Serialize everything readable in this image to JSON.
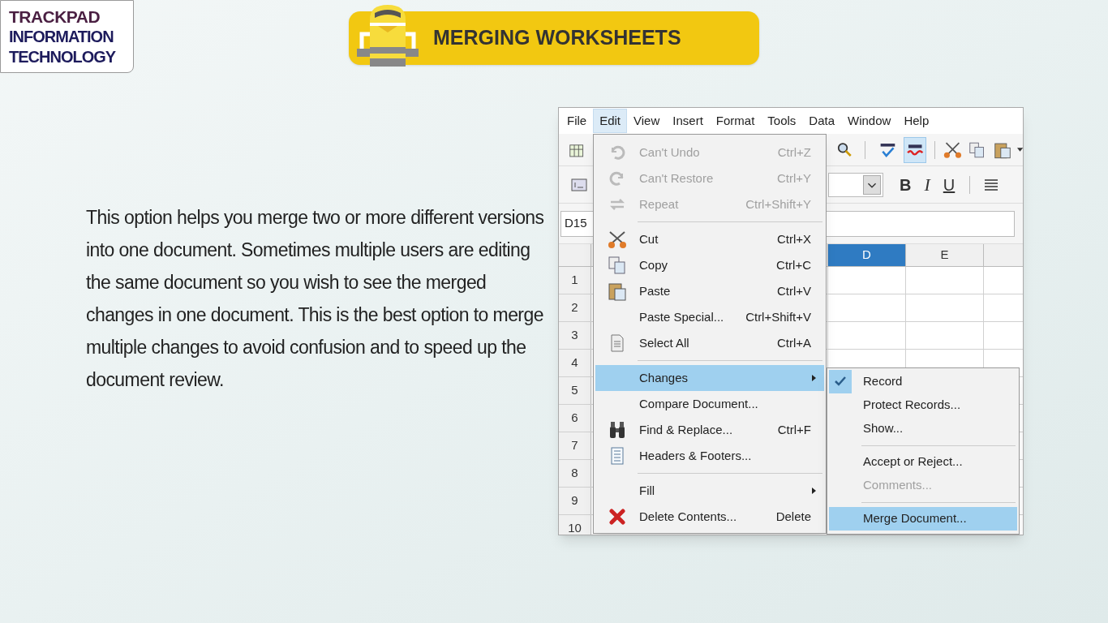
{
  "slide": {
    "logo": {
      "line_1": "TRACKPAD",
      "line_2": "INFORMATION",
      "line_3": "TECHNOLOGY"
    },
    "title": "MERGING WORKSHEETS",
    "paragraph": "This option helps you merge two or more different versions into one document. Sometimes multiple users are editing the same document so you wish to see the merged changes in one document. This is the best option to merge multiple changes to avoid confusion and to speed up the document review."
  },
  "screenshot": {
    "menu_bar": [
      {
        "label": "File",
        "selected": false
      },
      {
        "label": "Edit",
        "selected": true
      },
      {
        "label": "View",
        "selected": false
      },
      {
        "label": "Insert",
        "selected": false
      },
      {
        "label": "Format",
        "selected": false
      },
      {
        "label": "Tools",
        "selected": false
      },
      {
        "label": "Data",
        "selected": false
      },
      {
        "label": "Window",
        "selected": false
      },
      {
        "label": "Help",
        "selected": false
      }
    ],
    "format_buttons": [
      "B",
      "I",
      "U"
    ],
    "name_box": "D15",
    "columns": [
      {
        "label": "D",
        "selected": true
      },
      {
        "label": "E",
        "selected": false
      }
    ],
    "rows": [
      "1",
      "2",
      "3",
      "4",
      "5",
      "6",
      "7",
      "8",
      "9",
      "10"
    ],
    "edit_menu": [
      {
        "kind": "item",
        "label": "Can't Undo",
        "shortcut": "Ctrl+Z",
        "disabled": true,
        "selected": false,
        "submenu": false
      },
      {
        "kind": "item",
        "label": "Can't Restore",
        "shortcut": "Ctrl+Y",
        "disabled": true,
        "selected": false,
        "submenu": false
      },
      {
        "kind": "item",
        "label": "Repeat",
        "shortcut": "Ctrl+Shift+Y",
        "disabled": true,
        "selected": false,
        "submenu": false
      },
      {
        "kind": "separator"
      },
      {
        "kind": "item",
        "label": "Cut",
        "shortcut": "Ctrl+X",
        "disabled": false,
        "selected": false,
        "submenu": false
      },
      {
        "kind": "item",
        "label": "Copy",
        "shortcut": "Ctrl+C",
        "disabled": false,
        "selected": false,
        "submenu": false
      },
      {
        "kind": "item",
        "label": "Paste",
        "shortcut": "Ctrl+V",
        "disabled": false,
        "selected": false,
        "submenu": false
      },
      {
        "kind": "item",
        "label": "Paste Special...",
        "shortcut": "Ctrl+Shift+V",
        "disabled": false,
        "selected": false,
        "submenu": false
      },
      {
        "kind": "item",
        "label": "Select All",
        "shortcut": "Ctrl+A",
        "disabled": false,
        "selected": false,
        "submenu": false
      },
      {
        "kind": "separator"
      },
      {
        "kind": "item",
        "label": "Changes",
        "disabled": false,
        "selected": true,
        "submenu": true
      },
      {
        "kind": "item",
        "label": "Compare Document...",
        "disabled": false,
        "selected": false,
        "submenu": false
      },
      {
        "kind": "item",
        "label": "Find & Replace...",
        "shortcut": "Ctrl+F",
        "disabled": false,
        "selected": false,
        "submenu": false
      },
      {
        "kind": "item",
        "label": "Headers & Footers...",
        "disabled": false,
        "selected": false,
        "submenu": false
      },
      {
        "kind": "separator"
      },
      {
        "kind": "item",
        "label": "Fill",
        "disabled": false,
        "selected": false,
        "submenu": true
      },
      {
        "kind": "item",
        "label": "Delete Contents...",
        "shortcut": "Delete",
        "disabled": false,
        "selected": false,
        "submenu": false
      }
    ],
    "changes_submenu": [
      {
        "kind": "item",
        "label": "Record",
        "checked": true,
        "disabled": false,
        "selected": false
      },
      {
        "kind": "item",
        "label": "Protect Records...",
        "checked": false,
        "disabled": false,
        "selected": false
      },
      {
        "kind": "item",
        "label": "Show...",
        "checked": false,
        "disabled": false,
        "selected": false
      },
      {
        "kind": "separator"
      },
      {
        "kind": "item",
        "label": "Accept or Reject...",
        "checked": false,
        "disabled": false,
        "selected": false
      },
      {
        "kind": "item",
        "label": "Comments...",
        "checked": false,
        "disabled": true,
        "selected": false
      },
      {
        "kind": "separator"
      },
      {
        "kind": "item",
        "label": "Merge Document...",
        "checked": false,
        "disabled": false,
        "selected": true
      }
    ]
  }
}
